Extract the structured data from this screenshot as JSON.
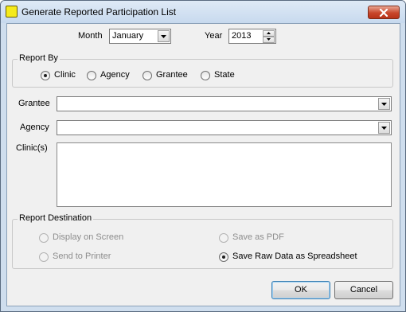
{
  "window": {
    "title": "Generate Reported Participation List"
  },
  "month": {
    "label": "Month",
    "value": "January"
  },
  "year": {
    "label": "Year",
    "value": "2013"
  },
  "report_by": {
    "title": "Report By",
    "options": [
      {
        "label": "Clinic",
        "checked": true
      },
      {
        "label": "Agency",
        "checked": false
      },
      {
        "label": "Grantee",
        "checked": false
      },
      {
        "label": "State",
        "checked": false
      }
    ]
  },
  "grantee": {
    "label": "Grantee",
    "value": ""
  },
  "agency": {
    "label": "Agency",
    "value": ""
  },
  "clinics": {
    "label": "Clinic(s)"
  },
  "destination": {
    "title": "Report Destination",
    "options": [
      {
        "label": "Display on Screen",
        "checked": false,
        "enabled": false
      },
      {
        "label": "Save as PDF",
        "checked": false,
        "enabled": false
      },
      {
        "label": "Send to Printer",
        "checked": false,
        "enabled": false
      },
      {
        "label": "Save Raw Data as Spreadsheet",
        "checked": true,
        "enabled": true
      }
    ]
  },
  "buttons": {
    "ok": "OK",
    "cancel": "Cancel"
  }
}
